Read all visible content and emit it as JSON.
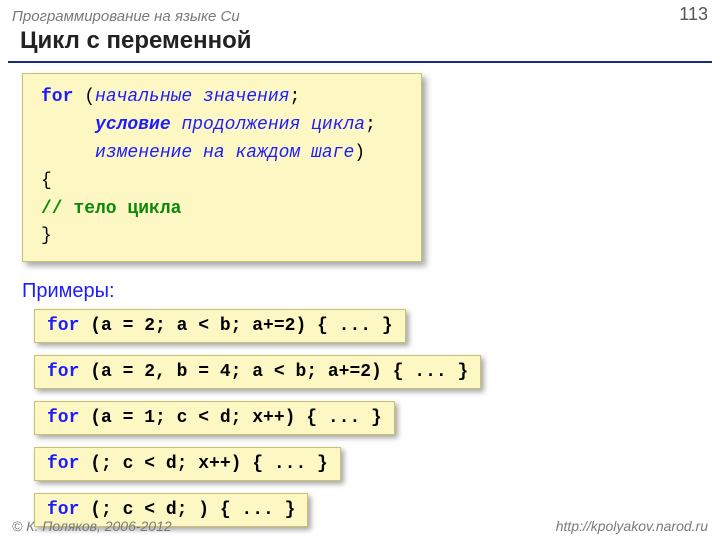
{
  "header": {
    "course": "Программирование на языке Си",
    "page": "113"
  },
  "title": "Цикл с переменной",
  "syntax": {
    "for": "for",
    "line1a": " (",
    "line1b": "начальные значения",
    "line1c": ";",
    "line2a": "     ",
    "line2b": "условие",
    "line2c": " продолжения цикла",
    "line2d": ";",
    "line3a": "     ",
    "line3b": "изменение на каждом шаге",
    "line3c": ")",
    "line4": "{",
    "line5": "// тело цикла",
    "line6": "}"
  },
  "examples_label": "Примеры:",
  "examples": [
    {
      "for": "for",
      "rest": " (a = 2; a < b; a+=2) { ... }"
    },
    {
      "for": "for",
      "rest": " (a = 2, b = 4; a < b; a+=2) { ... }"
    },
    {
      "for": "for",
      "rest": " (a = 1; c < d; x++) { ... }"
    },
    {
      "for": "for",
      "rest": " (; c < d; x++) { ... }"
    },
    {
      "for": "for",
      "rest": " (; c < d; ) { ... }"
    }
  ],
  "footer": {
    "copyright": "© К. Поляков, 2006-2012",
    "url": "http://kpolyakov.narod.ru"
  }
}
